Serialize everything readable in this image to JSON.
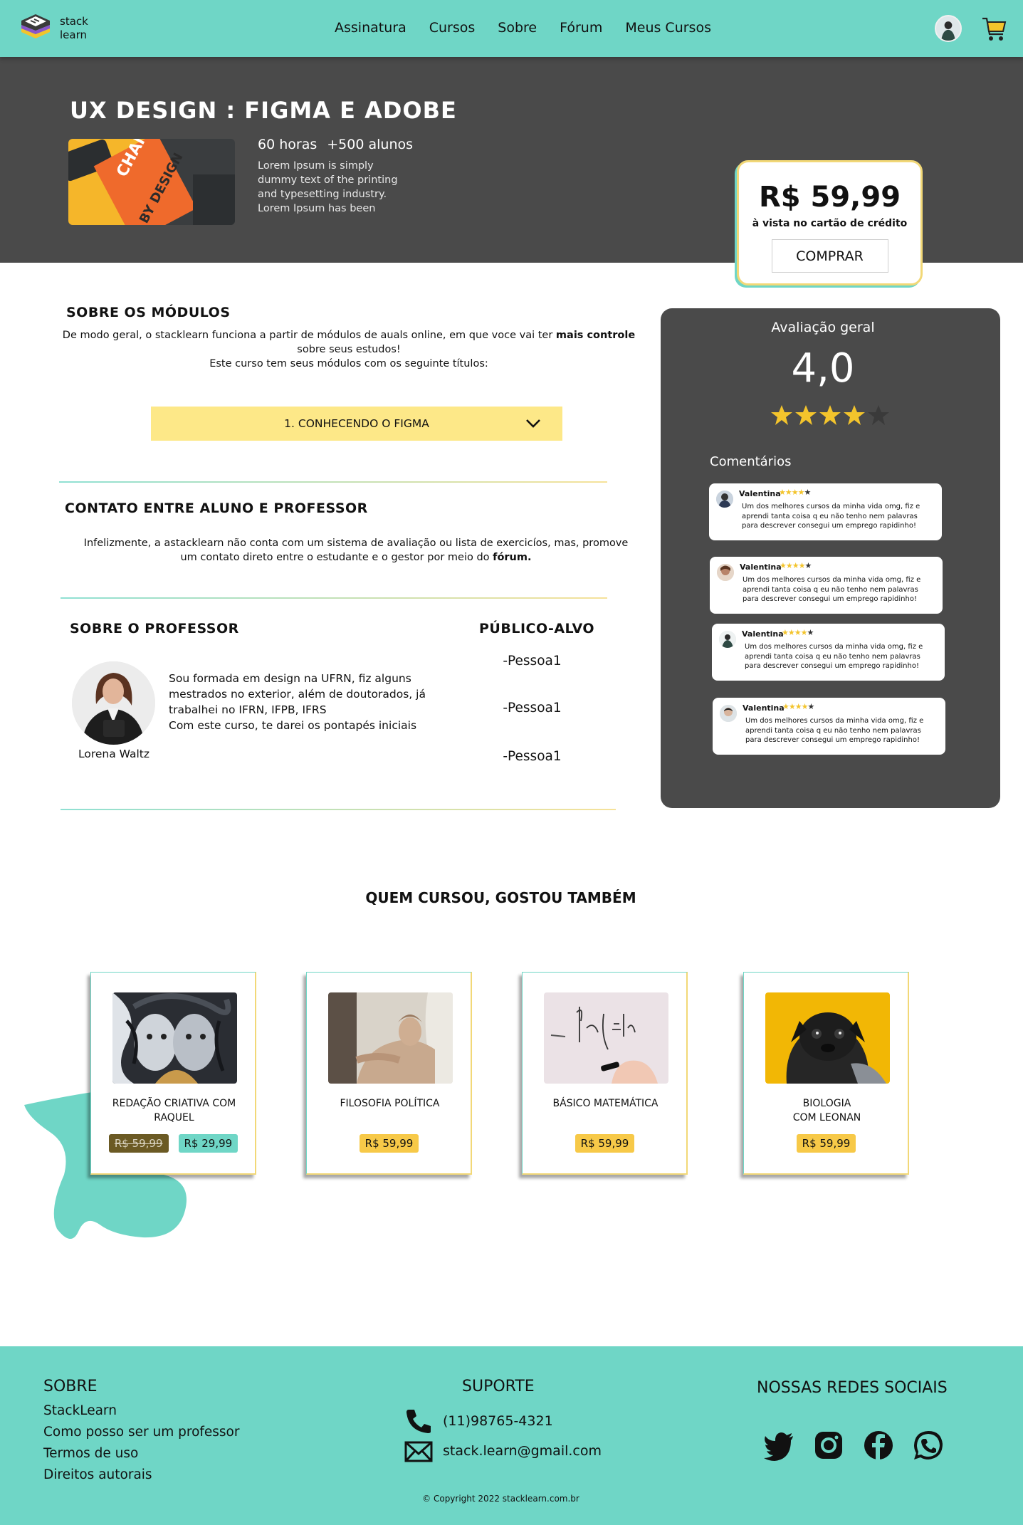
{
  "header": {
    "logo_line1": "stack",
    "logo_line2": "learn",
    "nav": [
      "Assinatura",
      "Cursos",
      "Sobre",
      "Fórum",
      "Meus Cursos"
    ]
  },
  "hero": {
    "title": "UX DESIGN : FIGMA E ADOBE",
    "hours": "60 horas",
    "students": "+500 alunos",
    "description": "Lorem Ipsum is simply dummy text of the printing and typesetting industry. Lorem Ipsum has been",
    "price": "R$ 59,99",
    "price_note": "à vista no cartão de crédito",
    "buy_label": "COMPRAR"
  },
  "modules": {
    "title": "SOBRE OS MÓDULOS",
    "text_before": "De modo geral, o stacklearn funciona a partir de módulos de auals online, em que voce vai ter ",
    "text_bold": "mais controle",
    "text_after": " sobre seus estudos!",
    "text_line2": "Este curso tem seus módulos com os seguinte títulos:",
    "accordion_label": "1. CONHECENDO O FIGMA"
  },
  "contact": {
    "title": "CONTATO ENTRE ALUNO E PROFESSOR",
    "text": "Infelizmente, a astacklearn não conta com um sistema de avaliação ou lista de exercicíos, mas, promove um contato direto entre o estudante e o gestor por meio do ",
    "text_bold": "fórum."
  },
  "professor": {
    "title": "SOBRE O PROFESSOR",
    "name": "Lorena Waltz",
    "bio": "Sou formada em design na UFRN, fiz alguns mestrados no exterior, além de doutorados, já trabalhei no IFRN, IFPB, IFRS",
    "bio2": "Com este curso, te darei os pontapés iniciais"
  },
  "audience": {
    "title": "PÚBLICO-ALVO",
    "items": [
      "-Pessoa1",
      "-Pessoa1",
      "-Pessoa1"
    ]
  },
  "rating": {
    "title": "Avaliação geral",
    "score": "4,0",
    "score_value": 4,
    "stars_total": 5,
    "comments_title": "Comentários",
    "comments": [
      {
        "name": "Valentina",
        "stars": 4,
        "text": "Um dos melhores cursos da minha vida omg, fiz e aprendi tanta coisa q eu não tenho nem palavras para descrever consegui um emprego rapidinho!"
      },
      {
        "name": "Valentina",
        "stars": 4,
        "text": "Um dos melhores cursos da minha vida omg, fiz e aprendi tanta coisa q eu não tenho nem palavras para descrever consegui um emprego rapidinho!"
      },
      {
        "name": "Valentina",
        "stars": 4,
        "text": "Um dos melhores cursos da minha vida omg, fiz e aprendi tanta coisa q eu não tenho nem palavras para descrever consegui um emprego rapidinho!"
      },
      {
        "name": "Valentina",
        "stars": 4,
        "text": "Um dos melhores cursos da minha vida omg, fiz e aprendi tanta coisa q eu não tenho nem palavras para descrever consegui um emprego rapidinho!"
      }
    ]
  },
  "recommendations": {
    "title": "QUEM CURSOU, GOSTOU TAMBÉM",
    "courses": [
      {
        "name_line1": "REDAÇÃO CRIATIVA COM",
        "name_line2": "RAQUEL",
        "old_price": "R$ 59,99",
        "price": "R$ 29,99"
      },
      {
        "name_line1": "FILOSOFIA POLÍTICA",
        "name_line2": "",
        "price": "R$ 59,99"
      },
      {
        "name_line1": "BÁSICO MATEMÁTICA",
        "name_line2": "",
        "price": "R$ 59,99"
      },
      {
        "name_line1": "BIOLOGIA",
        "name_line2": "COM LEONAN",
        "price": "R$ 59,99"
      }
    ]
  },
  "footer": {
    "about_title": "SOBRE",
    "about_links": [
      "StackLearn",
      "Como posso ser um professor",
      "Termos de uso",
      "Direitos autorais"
    ],
    "support_title": "SUPORTE",
    "phone": "(11)98765-4321",
    "email": "stack.learn@gmail.com",
    "social_title": "NOSSAS REDES SOCIAIS",
    "social_icons": [
      "twitter-icon",
      "instagram-icon",
      "facebook-icon",
      "whatsapp-icon"
    ],
    "copyright": "© Copyright 2022 stacklearn.com.br"
  },
  "colors": {
    "teal": "#6fd6c6",
    "dark": "#4a4a4a",
    "yellow": "#f7c948",
    "accordion": "#fde888"
  }
}
